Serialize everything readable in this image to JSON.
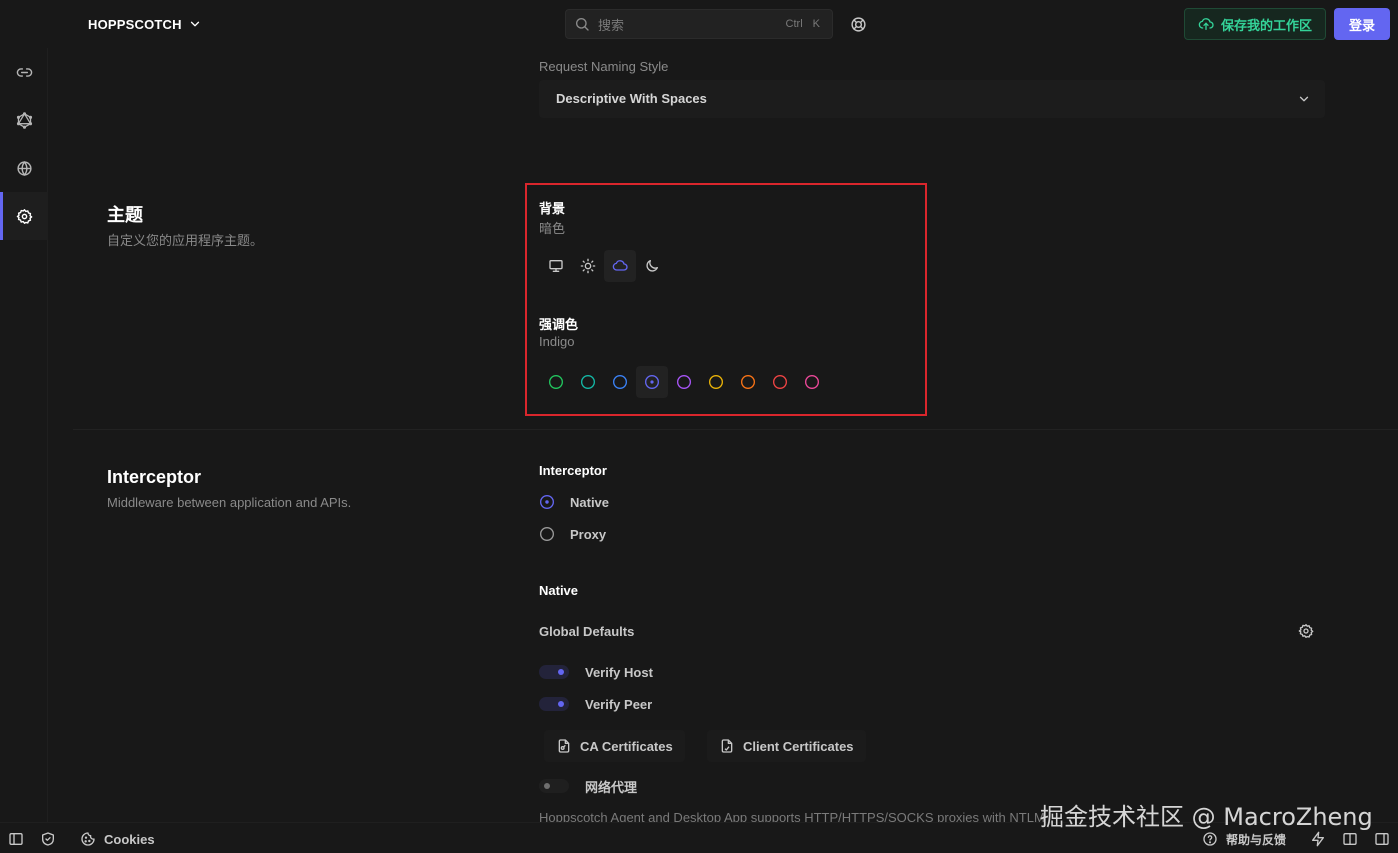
{
  "header": {
    "workspace": "HOPPSCOTCH",
    "search_placeholder": "搜索",
    "search_shortcut": [
      "Ctrl",
      "K"
    ],
    "save_workspace": "保存我的工作区",
    "login": "登录"
  },
  "sidebar": {
    "items": [
      {
        "name": "rest",
        "icon": "link-icon"
      },
      {
        "name": "graphql",
        "icon": "graphql-icon"
      },
      {
        "name": "realtime",
        "icon": "globe-icon"
      },
      {
        "name": "settings",
        "icon": "gear-icon",
        "active": true
      }
    ]
  },
  "settings": {
    "request_naming": {
      "label": "Request Naming Style",
      "value": "Descriptive With Spaces"
    },
    "theme": {
      "title": "主题",
      "description": "自定义您的应用程序主题。",
      "background_label": "背景",
      "background_value": "暗色",
      "background_options": [
        {
          "icon": "monitor-icon",
          "selected": false
        },
        {
          "icon": "sun-icon",
          "selected": false
        },
        {
          "icon": "cloud-icon",
          "selected": true
        },
        {
          "icon": "moon-icon",
          "selected": false
        }
      ],
      "accent_label": "强调色",
      "accent_value": "Indigo",
      "accent_colors": [
        {
          "color": "#22c55e",
          "selected": false
        },
        {
          "color": "#14b8a6",
          "selected": false
        },
        {
          "color": "#3b82f6",
          "selected": false
        },
        {
          "color": "#6366f1",
          "selected": true
        },
        {
          "color": "#a855f7",
          "selected": false
        },
        {
          "color": "#eab308",
          "selected": false
        },
        {
          "color": "#f97316",
          "selected": false
        },
        {
          "color": "#ef4444",
          "selected": false
        },
        {
          "color": "#ec4899",
          "selected": false
        }
      ]
    },
    "interceptor": {
      "title": "Interceptor",
      "description": "Middleware between application and APIs.",
      "label": "Interceptor",
      "options": [
        {
          "label": "Native",
          "selected": true
        },
        {
          "label": "Proxy",
          "selected": false
        }
      ],
      "native_title": "Native",
      "global_defaults": "Global Defaults",
      "verify_host": "Verify Host",
      "verify_host_on": true,
      "verify_peer": "Verify Peer",
      "verify_peer_on": true,
      "ca_certificates": "CA Certificates",
      "client_certificates": "Client Certificates",
      "network_proxy": "网络代理",
      "network_proxy_on": false,
      "proxy_note": "Hoppscotch Agent and Desktop App supports HTTP/HTTPS/SOCKS proxies with NTLM"
    }
  },
  "footer": {
    "cookies": "Cookies",
    "help": "帮助与反馈"
  },
  "watermark": "掘金技术社区 @ MacroZheng",
  "colors": {
    "accent": "#6366f1",
    "save_green": "#34d399",
    "highlight_red": "#d9262c"
  }
}
